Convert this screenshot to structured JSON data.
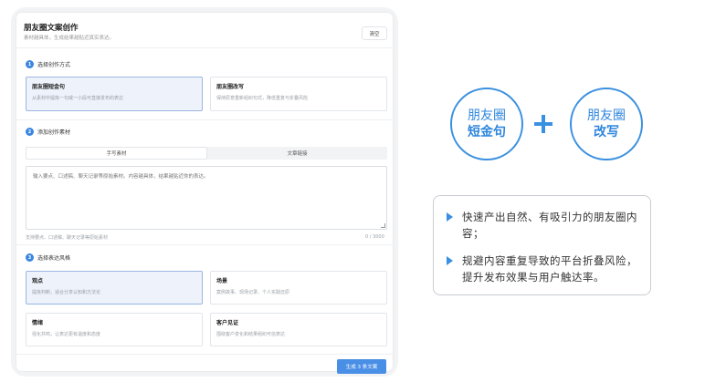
{
  "header": {
    "title": "朋友圈文案创作",
    "subtitle": "素材越具体，生成结果越贴近真实表达。",
    "clear_label": "清空"
  },
  "step1": {
    "num": "1",
    "label": "选择创作方式",
    "cards": [
      {
        "title": "朋友圈短金句",
        "desc": "从素材中提炼一句或一小段可直接发布的表达",
        "selected": true
      },
      {
        "title": "朋友圈改写",
        "desc": "保持原意重新组织句式，降低重复与折叠风险",
        "selected": false
      }
    ]
  },
  "step2": {
    "num": "2",
    "label": "添加创作素材",
    "tabs": [
      "手写素材",
      "文章链接"
    ],
    "textarea_placeholder": "输入要点、口述稿、聊天记录等原始素材。内容越具体，结果越贴近你的表达。",
    "hint": "支持要点、口述稿、聊天记录等原始素材",
    "counter": "0 / 3000"
  },
  "step3": {
    "num": "3",
    "label": "选择表达风格",
    "cards": [
      {
        "title": "观点",
        "desc": "提炼判断，适合分享认知和方法论",
        "selected": true
      },
      {
        "title": "场景",
        "desc": "案例故事、现场记录、个人实践还原",
        "selected": false
      },
      {
        "title": "情绪",
        "desc": "强化共鸣，让表达更有温度和态度",
        "selected": false
      },
      {
        "title": "客户见证",
        "desc": "围绕客户变化和结果组织可信表达",
        "selected": false
      }
    ]
  },
  "generate_label": "生成 3 条文案",
  "diagram": {
    "circle_left": {
      "line1": "朋友圈",
      "line2": "短金句"
    },
    "circle_right": {
      "line1": "朋友圈",
      "line2": "改写"
    }
  },
  "bullets": [
    "快速产出自然、有吸引力的朋友圈内容；",
    "规避内容重复导致的平台折叠风险，提升发布效果与用户触达率。"
  ],
  "colors": {
    "accent": "#3a90e0",
    "selected_bg": "#edf2fb"
  }
}
